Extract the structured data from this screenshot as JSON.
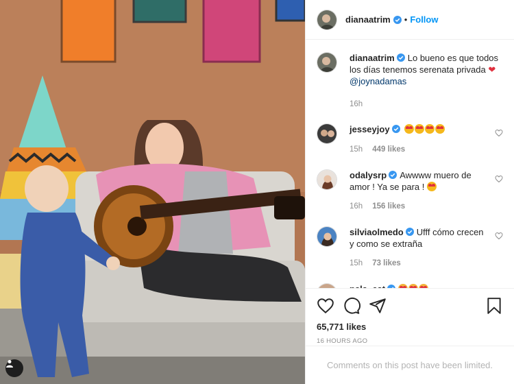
{
  "post": {
    "author": "dianaatrim",
    "follow_label": "Follow",
    "separator": "•",
    "caption_text": "Lo bueno es que todos los días tenemos serenata privada",
    "caption_mention": "@joynadamas",
    "caption_time": "16h"
  },
  "comments": [
    {
      "user": "jesseyjoy",
      "time": "15h",
      "likes": "449 likes",
      "emoji_count": 4
    },
    {
      "user": "odalysrp",
      "text": "Awwww muero de amor ! Ya se para !",
      "time": "16h",
      "likes": "156 likes"
    },
    {
      "user": "silviaolmedo",
      "text": "Ufff cómo crecen y como se extraña",
      "time": "15h",
      "likes": "73 likes"
    },
    {
      "user": "pala_cat"
    }
  ],
  "engagement": {
    "likes": "65,771 likes",
    "timestamp": "16 HOURS AGO",
    "comments_limited": "Comments on this post have been limited."
  },
  "icons": [
    "verified-badge-icon",
    "heart-icon",
    "comment-icon",
    "share-icon",
    "bookmark-icon",
    "user-tag-icon"
  ],
  "colors": {
    "accent": "#0095f6",
    "verified": "#3897f0",
    "muted": "#8e8e8e",
    "border": "#efefef"
  }
}
